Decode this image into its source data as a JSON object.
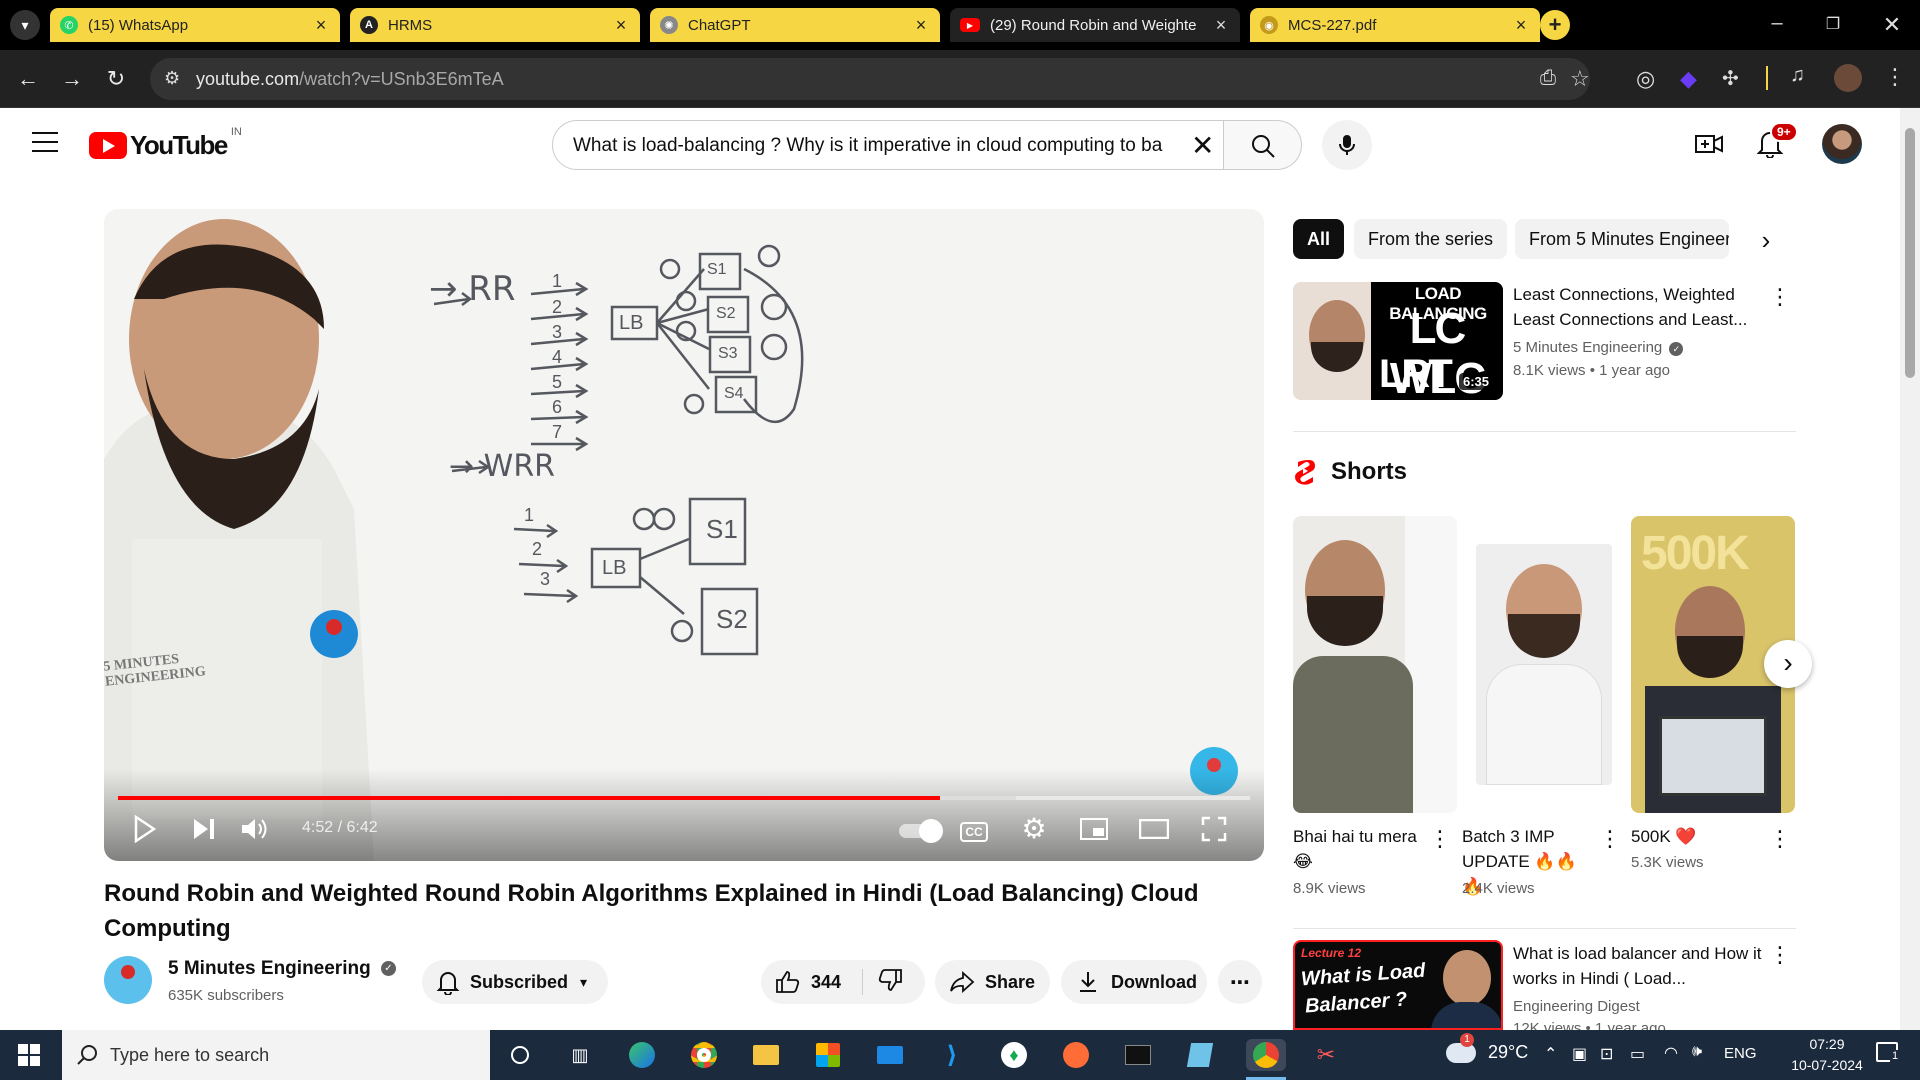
{
  "browser": {
    "tabs": [
      {
        "label": "(15) WhatsApp",
        "color": "#25d366",
        "icon": "whatsapp-icon"
      },
      {
        "label": "HRMS",
        "color": "#222222",
        "icon": "hrms-icon"
      },
      {
        "label": "ChatGPT",
        "color": "#10a37f",
        "icon": "chatgpt-icon"
      },
      {
        "label": "(29) Round Robin and Weighte",
        "color": "#ff0000",
        "icon": "youtube-icon",
        "active": true
      },
      {
        "label": "MCS-227.pdf",
        "color": "#f2c230",
        "icon": "pdf-icon"
      }
    ],
    "url_host": "youtube.com",
    "url_path": "/watch?v=USnb3E6mTeA"
  },
  "youtube": {
    "logo_text": "YouTube",
    "country": "IN",
    "search_value": "What is load-balancing ? Why is it imperative in cloud computing to ba",
    "notif_badge": "9+"
  },
  "player": {
    "time_current": "4:52",
    "time_total": "6:42",
    "progress": 0.726,
    "buffered": 0.793,
    "watermark": "5 MINUTES ENGINEERING",
    "board": {
      "rr": "→ RR",
      "wrr": "→ WRR",
      "lb": "LB",
      "servers": [
        "S1",
        "S2",
        "S3",
        "S4"
      ],
      "nums": [
        "1",
        "2",
        "3",
        "4",
        "5",
        "6",
        "7"
      ],
      "w_nums": [
        "1",
        "2",
        "3"
      ],
      "w_servers": [
        "S1",
        "S2"
      ]
    }
  },
  "video": {
    "title": "Round Robin and Weighted Round Robin Algorithms Explained in Hindi (Load Balancing) Cloud Computing",
    "channel": "5 Minutes Engineering",
    "subscribers": "635K subscribers",
    "subscribe_label": "Subscribed",
    "likes": "344",
    "share_label": "Share",
    "download_label": "Download"
  },
  "chips": [
    "All",
    "From the series",
    "From 5 Minutes Engineeri"
  ],
  "related_top": {
    "thumb_lines": [
      "LOAD BALANCING",
      "LC WLC",
      "LRT"
    ],
    "duration": "6:35",
    "title": "Least Connections, Weighted Least Connections and Least...",
    "channel": "5 Minutes Engineering",
    "meta": "8.1K views • 1 year ago"
  },
  "shorts": {
    "heading": "Shorts",
    "items": [
      {
        "title": "Bhai hai tu mera 😂",
        "views": "8.9K views"
      },
      {
        "title": "Batch 3 IMP UPDATE 🔥🔥🔥",
        "views": "2.4K views"
      },
      {
        "title": "500K ❤️",
        "views": "5.3K views",
        "thumb_text": "500K"
      }
    ]
  },
  "related_bottom": {
    "thumb_lines": [
      "Lecture 12",
      "What is Load",
      "Balancer ?"
    ],
    "title": "What is load balancer and How it works in Hindi ( Load...",
    "channel": "Engineering Digest",
    "meta": "12K views • 1 year ago"
  },
  "taskbar": {
    "search_placeholder": "Type here to search",
    "weather": "29°C",
    "lang": "ENG",
    "time": "07:29",
    "date": "10-07-2024",
    "notif_count": "1"
  }
}
